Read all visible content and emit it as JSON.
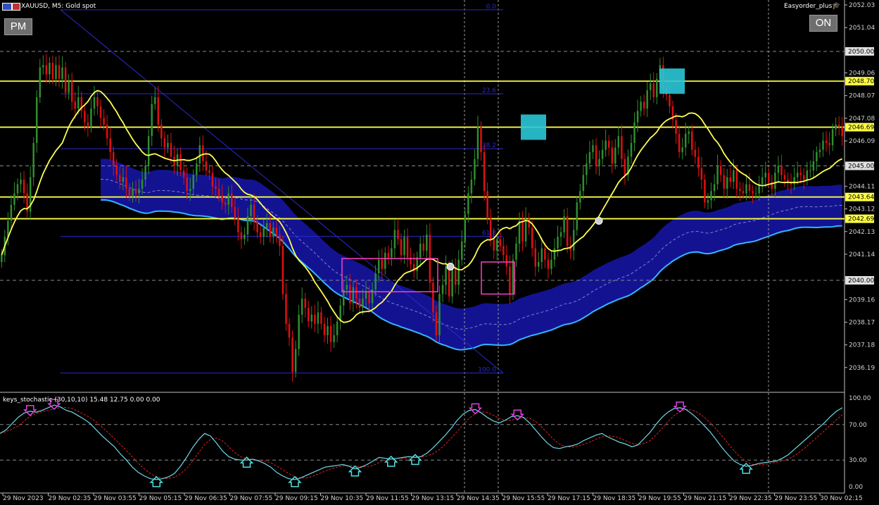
{
  "header": {
    "symbol": "XAUUSD,",
    "timeframe": "M5:",
    "description": "Gold spot",
    "ea_name": "Easyorder_plus"
  },
  "buttons": {
    "pm": "PM",
    "on": "ON"
  },
  "indicator": {
    "label": "keys_stochastic (30,10,10) 15.48 12.75 0.00 0.00"
  },
  "colors": {
    "background": "#000000",
    "bull": "#2f8f2f",
    "bear": "#e01010",
    "ma": "#ffff55",
    "band_fill": "#14149a",
    "band_lower": "#34b4ff",
    "level_line": "#ffff44",
    "fib_line": "#2a2ad0",
    "stoch_main": "#6fd8e8",
    "stoch_signal": "#e02020",
    "signal_box": "#2ac8d8",
    "arrow_down": "#e040e0",
    "arrow_up": "#50e0e0"
  },
  "chart_data": [
    {
      "type": "candlestick",
      "symbol": "XAUUSD",
      "timeframe": "M5",
      "ylim": [
        2035.2,
        2052.03
      ],
      "y_ticks": [
        "2052.03",
        "2051.04",
        "2049.06",
        "2048.07",
        "2047.08",
        "2046.09",
        "2044.11",
        "2043.12",
        "2042.13",
        "2041.14",
        "2039.16",
        "2038.17",
        "2037.18",
        "2036.19"
      ],
      "price_tags": [
        {
          "value": 2050.0,
          "style": "gray"
        },
        {
          "value": 2048.7,
          "style": "yellow"
        },
        {
          "value": 2046.69,
          "style": "yellow"
        },
        {
          "value": 2045.0,
          "style": "gray"
        },
        {
          "value": 2043.64,
          "style": "yellow"
        },
        {
          "value": 2042.69,
          "style": "yellow"
        },
        {
          "value": 2040.0,
          "style": "gray"
        }
      ],
      "horizontal_levels": [
        2048.7,
        2046.69,
        2043.64,
        2042.69
      ],
      "grid_levels": [
        2050.0,
        2045.0,
        2040.0
      ],
      "fib_levels": [
        {
          "label": "0.0",
          "value": 2051.82
        },
        {
          "label": "23.6",
          "value": 2048.15
        },
        {
          "label": "38.2",
          "value": 2045.75
        },
        {
          "label": "61.8",
          "value": 2041.92
        },
        {
          "label": "100.0",
          "value": 2035.95
        }
      ],
      "x_labels": [
        "29 Nov 2023",
        "29 Nov 02:35",
        "29 Nov 03:55",
        "29 Nov 05:15",
        "29 Nov 06:35",
        "29 Nov 07:55",
        "29 Nov 09:15",
        "29 Nov 10:35",
        "29 Nov 11:55",
        "29 Nov 13:15",
        "29 Nov 14:35",
        "29 Nov 15:55",
        "29 Nov 17:15",
        "29 Nov 18:35",
        "29 Nov 19:55",
        "29 Nov 21:15",
        "29 Nov 22:35",
        "29 Nov 23:55",
        "30 Nov 02:15"
      ],
      "close": [
        2041.1,
        2041.9,
        2042.6,
        2043.3,
        2043.8,
        2044.2,
        2044.4,
        2043.8,
        2043.0,
        2044.5,
        2046.0,
        2048.0,
        2049.3,
        2049.4,
        2049.0,
        2049.5,
        2048.8,
        2049.4,
        2048.8,
        2049.3,
        2048.2,
        2048.7,
        2047.8,
        2047.5,
        2048.0,
        2047.4,
        2046.9,
        2046.7,
        2047.5,
        2048.0,
        2047.6,
        2047.1,
        2046.8,
        2046.2,
        2045.6,
        2045.0,
        2044.6,
        2044.3,
        2044.5,
        2044.0,
        2043.7,
        2044.0,
        2043.8,
        2044.0,
        2044.4,
        2045.0,
        2046.3,
        2047.7,
        2048.0,
        2046.8,
        2046.2,
        2045.8,
        2046.0,
        2045.4,
        2045.0,
        2045.5,
        2044.8,
        2044.5,
        2043.9,
        2044.0,
        2044.6,
        2045.1,
        2045.9,
        2045.2,
        2044.8,
        2044.7,
        2044.1,
        2044.0,
        2043.7,
        2043.4,
        2043.3,
        2043.8,
        2043.2,
        2042.7,
        2042.1,
        2041.8,
        2042.0,
        2042.8,
        2043.3,
        2042.6,
        2042.1,
        2041.9,
        2042.3,
        2042.5,
        2041.9,
        2042.3,
        2042.0,
        2041.5,
        2039.4,
        2038.1,
        2037.5,
        2036.0,
        2037.0,
        2038.5,
        2039.2,
        2038.8,
        2038.2,
        2038.5,
        2038.1,
        2038.6,
        2038.1,
        2037.6,
        2038.0,
        2037.3,
        2037.6,
        2038.2,
        2038.9,
        2039.6,
        2039.8,
        2039.0,
        2039.7,
        2039.2,
        2038.8,
        2039.2,
        2039.5,
        2039.0,
        2039.6,
        2040.3,
        2040.9,
        2040.5,
        2041.2,
        2041.0,
        2041.4,
        2042.2,
        2041.8,
        2041.1,
        2041.9,
        2041.0,
        2040.7,
        2040.4,
        2041.0,
        2041.6,
        2041.3,
        2042.0,
        2039.9,
        2038.6,
        2037.6,
        2039.4,
        2039.8,
        2040.6,
        2039.3,
        2040.6,
        2039.8,
        2040.9,
        2041.7,
        2042.9,
        2043.8,
        2044.4,
        2045.3,
        2046.7,
        2045.6,
        2043.9,
        2042.7,
        2041.8,
        2041.3,
        2041.8,
        2041.5,
        2041.1,
        2040.6,
        2039.4,
        2040.9,
        2041.6,
        2042.6,
        2041.7,
        2042.7,
        2042.3,
        2041.4,
        2040.6,
        2040.8,
        2041.4,
        2040.9,
        2040.5,
        2040.9,
        2041.4,
        2041.9,
        2042.1,
        2042.8,
        2041.5,
        2041.3,
        2042.2,
        2043.4,
        2043.9,
        2044.6,
        2045.1,
        2045.6,
        2045.9,
        2045.0,
        2045.3,
        2045.7,
        2046.1,
        2045.8,
        2045.1,
        2045.8,
        2046.3,
        2045.3,
        2044.6,
        2045.4,
        2046.0,
        2046.9,
        2047.4,
        2047.8,
        2047.5,
        2048.3,
        2048.6,
        2048.0,
        2048.8,
        2049.4,
        2048.4,
        2048.1,
        2047.6,
        2047.0,
        2046.4,
        2045.6,
        2045.8,
        2046.4,
        2046.5,
        2045.7,
        2045.4,
        2044.9,
        2044.4,
        2043.4,
        2043.5,
        2043.9,
        2044.2,
        2045.0,
        2044.6,
        2044.0,
        2044.5,
        2044.3,
        2044.8,
        2044.0,
        2043.9,
        2043.8,
        2044.2,
        2043.9,
        2043.8,
        2043.8,
        2044.2,
        2044.5,
        2044.7,
        2044.3,
        2044.0,
        2044.7,
        2045.0,
        2044.6,
        2044.4,
        2044.3,
        2044.2,
        2044.5,
        2044.7,
        2044.6,
        2044.4,
        2044.8,
        2044.8,
        2045.2,
        2045.6,
        2045.7,
        2046.1,
        2046.0,
        2045.9,
        2046.6,
        2046.8,
        2046.7,
        2046.3
      ]
    },
    {
      "type": "line",
      "name": "keys_stochastic (30,10,10)",
      "ylim": [
        0,
        100
      ],
      "y_ticks": [
        "100.00",
        "70.00",
        "30.00",
        "0.00"
      ],
      "levels": [
        70,
        30
      ],
      "main": [
        60,
        64,
        71,
        78,
        83,
        85,
        84,
        86,
        89,
        92,
        90,
        86,
        84,
        80,
        76,
        71,
        64,
        57,
        51,
        45,
        37,
        30,
        22,
        16,
        12,
        9,
        8,
        9,
        11,
        15,
        23,
        33,
        44,
        53,
        60,
        57,
        49,
        40,
        34,
        31,
        30,
        30,
        31,
        29,
        26,
        22,
        16,
        12,
        9,
        8,
        10,
        13,
        16,
        19,
        22,
        23,
        24,
        25,
        23,
        20,
        22,
        25,
        29,
        33,
        32,
        31,
        32,
        33,
        34,
        33,
        34,
        38,
        44,
        51,
        58,
        66,
        75,
        82,
        86,
        87,
        83,
        78,
        74,
        72,
        75,
        79,
        80,
        78,
        72,
        64,
        56,
        49,
        44,
        43,
        45,
        46,
        48,
        52,
        55,
        58,
        60,
        56,
        53,
        50,
        48,
        45,
        47,
        54,
        61,
        70,
        78,
        84,
        88,
        89,
        87,
        82,
        76,
        69,
        62,
        53,
        44,
        36,
        29,
        25,
        23,
        24,
        26,
        27,
        28,
        29,
        32,
        36,
        42,
        48,
        54,
        60,
        66,
        72,
        79,
        85,
        89
      ]
    }
  ]
}
